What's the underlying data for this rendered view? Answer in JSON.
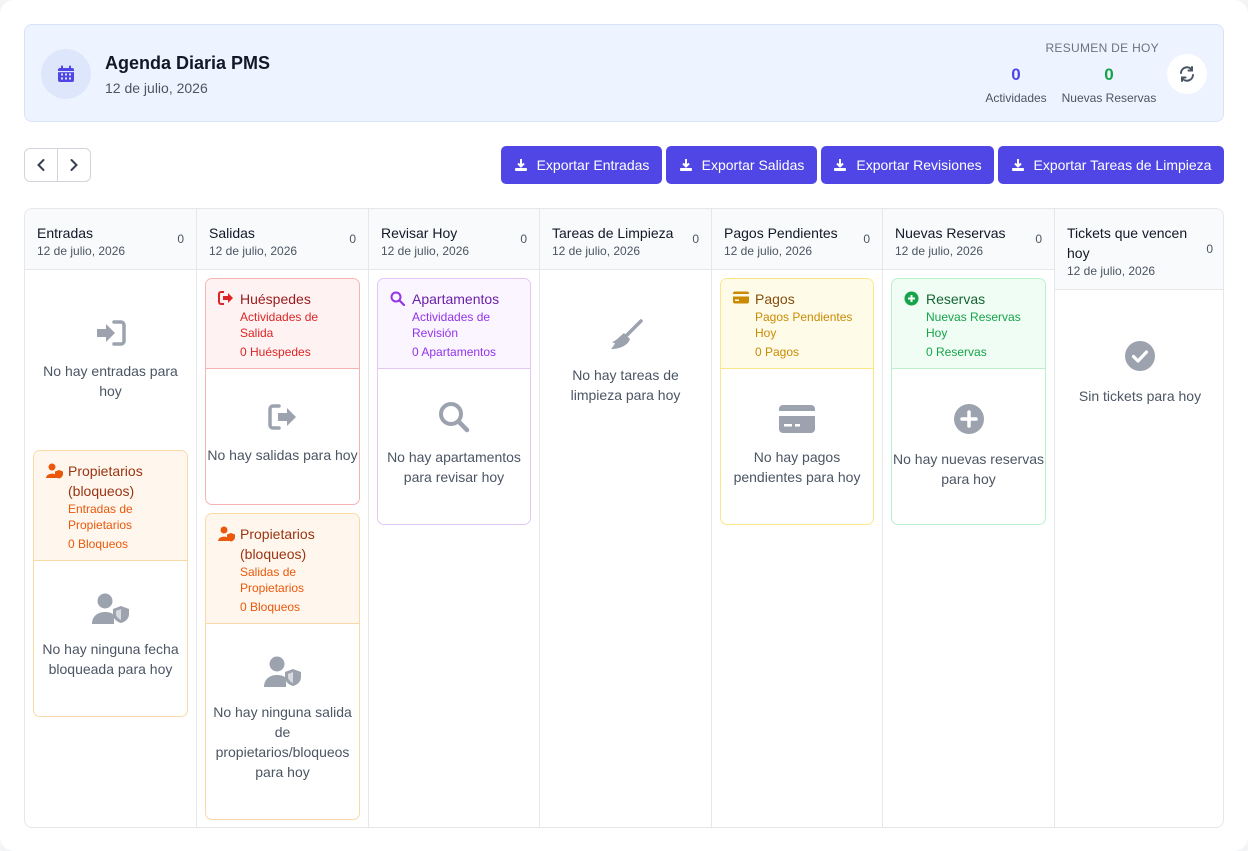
{
  "header": {
    "title": "Agenda Diaria PMS",
    "date": "12 de julio, 2026",
    "summary_label": "RESUMEN DE HOY",
    "stats": [
      {
        "value": "0",
        "label": "Actividades"
      },
      {
        "value": "0",
        "label": "Nuevas Reservas"
      }
    ]
  },
  "toolbar": {
    "export_buttons": [
      "Exportar Entradas",
      "Exportar Salidas",
      "Exportar Revisiones",
      "Exportar Tareas de Limpieza"
    ]
  },
  "columns": [
    {
      "title": "Entradas",
      "date": "12 de julio, 2026",
      "count": "0",
      "empty": "No hay entradas para hoy",
      "card": {
        "title": "Propietarios (bloqueos)",
        "subtitle": "Entradas de Propietarios",
        "count": "0 Bloqueos",
        "empty": "No hay ninguna fecha bloqueada para hoy"
      }
    },
    {
      "title": "Salidas",
      "date": "12 de julio, 2026",
      "count": "0",
      "cards": [
        {
          "title": "Huéspedes",
          "subtitle": "Actividades de Salida",
          "count": "0 Huéspedes",
          "empty": "No hay salidas para hoy"
        },
        {
          "title": "Propietarios (bloqueos)",
          "subtitle": "Salidas de Propietarios",
          "count": "0 Bloqueos",
          "empty": "No hay ninguna salida de propietarios/bloqueos para hoy"
        }
      ]
    },
    {
      "title": "Revisar Hoy",
      "date": "12 de julio, 2026",
      "count": "0",
      "card": {
        "title": "Apartamentos",
        "subtitle": "Actividades de Revisión",
        "count": "0 Apartamentos",
        "empty": "No hay apartamentos para revisar hoy"
      }
    },
    {
      "title": "Tareas de Limpieza",
      "date": "12 de julio, 2026",
      "count": "0",
      "empty": "No hay tareas de limpieza para hoy"
    },
    {
      "title": "Pagos Pendientes",
      "date": "12 de julio, 2026",
      "count": "0",
      "card": {
        "title": "Pagos",
        "subtitle": "Pagos Pendientes Hoy",
        "count": "0 Pagos",
        "empty": "No hay pagos pendientes para hoy"
      }
    },
    {
      "title": "Nuevas Reservas",
      "date": "12 de julio, 2026",
      "count": "0",
      "card": {
        "title": "Reservas",
        "subtitle": "Nuevas Reservas Hoy",
        "count": "0 Reservas",
        "empty": "No hay nuevas reservas para hoy"
      }
    },
    {
      "title": "Tickets que vencen hoy",
      "date": "12 de julio, 2026",
      "count": "0",
      "empty": "Sin tickets para hoy"
    }
  ],
  "colors": {
    "accent": "#4f46e5",
    "success": "#16a34a"
  },
  "icons": [
    "calendar-icon",
    "refresh-icon",
    "chevron-left-icon",
    "chevron-right-icon",
    "download-icon",
    "sign-in-icon",
    "sign-out-icon",
    "user-shield-icon",
    "search-icon",
    "broom-icon",
    "credit-card-icon",
    "plus-circle-icon",
    "check-circle-icon"
  ]
}
